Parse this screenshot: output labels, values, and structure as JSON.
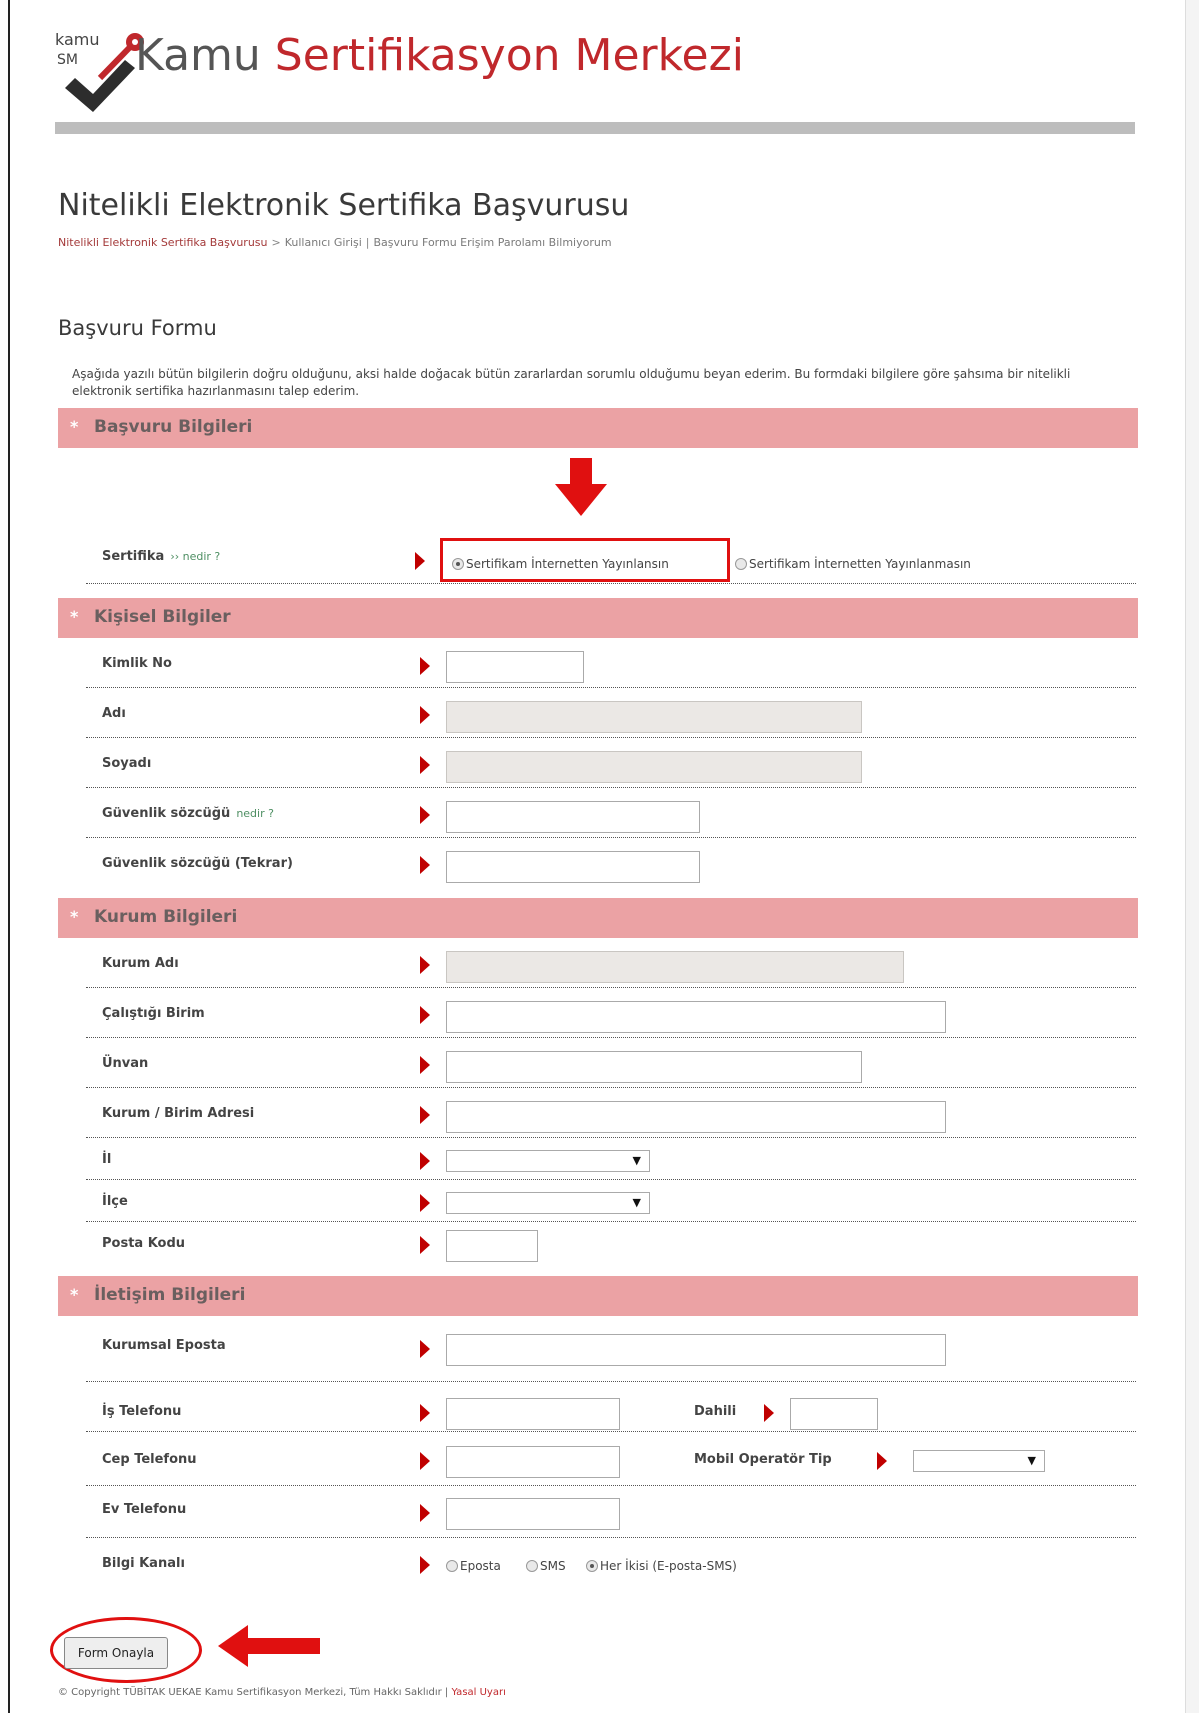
{
  "header": {
    "logo_text_top": "kamu",
    "logo_text_bottom": "SM",
    "title_part1": "Kamu",
    "title_part2": "Sertifikasyon Merkezi"
  },
  "page": {
    "title": "Nitelikli Elektronik Sertifika Başvurusu",
    "breadcrumb": {
      "item1": "Nitelikli Elektronik Sertifika Başvurusu",
      "sep1": ">",
      "item2": "Kullanıcı Girişi",
      "sep2": "|",
      "item3": "Başvuru Formu Erişim Parolamı Bilmiyorum"
    },
    "form_title": "Başvuru Formu",
    "intro": "Aşağıda yazılı bütün bilgilerin doğru olduğunu, aksi halde doğacak bütün zararlardan sorumlu olduğumu beyan ederim. Bu formdaki bilgilere göre şahsıma bir nitelikli elektronik sertifika hazırlanmasını talep ederim."
  },
  "sections": {
    "basvuru": {
      "star": "*",
      "label": "Başvuru Bilgileri"
    },
    "kisisel": {
      "star": "*",
      "label": "Kişisel Bilgiler"
    },
    "kurum": {
      "star": "*",
      "label": "Kurum Bilgileri"
    },
    "iletisim": {
      "star": "*",
      "label": "İletişim Bilgileri"
    }
  },
  "fields": {
    "sertifika": {
      "label": "Sertifika",
      "link": "›› nedir ?",
      "option1": "Sertifikam İnternetten Yayınlansın",
      "option2": "Sertifikam İnternetten Yayınlanmasın",
      "selected": "option1"
    },
    "kimlik_no": {
      "label": "Kimlik No",
      "value": ""
    },
    "adi": {
      "label": "Adı",
      "value": ""
    },
    "soyadi": {
      "label": "Soyadı",
      "value": ""
    },
    "guvenlik": {
      "label": "Güvenlik sözcüğü",
      "link": "nedir ?",
      "value": ""
    },
    "guvenlik_tekrar": {
      "label": "Güvenlik sözcüğü (Tekrar)",
      "value": ""
    },
    "kurum_adi": {
      "label": "Kurum Adı",
      "value": ""
    },
    "birim": {
      "label": "Çalıştığı Birim",
      "value": ""
    },
    "unvan": {
      "label": "Ünvan",
      "value": ""
    },
    "adres": {
      "label": "Kurum / Birim Adresi",
      "value": ""
    },
    "il": {
      "label": "İl",
      "value": ""
    },
    "ilce": {
      "label": "İlçe",
      "value": ""
    },
    "posta_kodu": {
      "label": "Posta Kodu",
      "value": ""
    },
    "eposta": {
      "label": "Kurumsal Eposta",
      "value": ""
    },
    "is_tel": {
      "label": "İş Telefonu",
      "value": ""
    },
    "dahili": {
      "label": "Dahili",
      "value": ""
    },
    "cep_tel": {
      "label": "Cep Telefonu",
      "value": ""
    },
    "operator": {
      "label": "Mobil Operatör Tip",
      "value": ""
    },
    "ev_tel": {
      "label": "Ev Telefonu",
      "value": ""
    },
    "bilgi_kanali": {
      "label": "Bilgi Kanalı",
      "option1": "Eposta",
      "option2": "SMS",
      "option3": "Her İkisi (E-posta-SMS)",
      "selected": "option3"
    }
  },
  "actions": {
    "submit": "Form Onayla"
  },
  "footer": {
    "copyright": "© Copyright TÜBİTAK UEKAE Kamu Sertifikasyon Merkezi, Tüm Hakkı Saklıdır |",
    "link": "Yasal Uyarı"
  },
  "colors": {
    "accent": "#c0282c",
    "section_bg": "#eba2a4",
    "annotation": "#e01010"
  },
  "icons": {
    "field_marker": "red-triangle-icon",
    "annotation_arrow": "red-arrow-icon"
  }
}
